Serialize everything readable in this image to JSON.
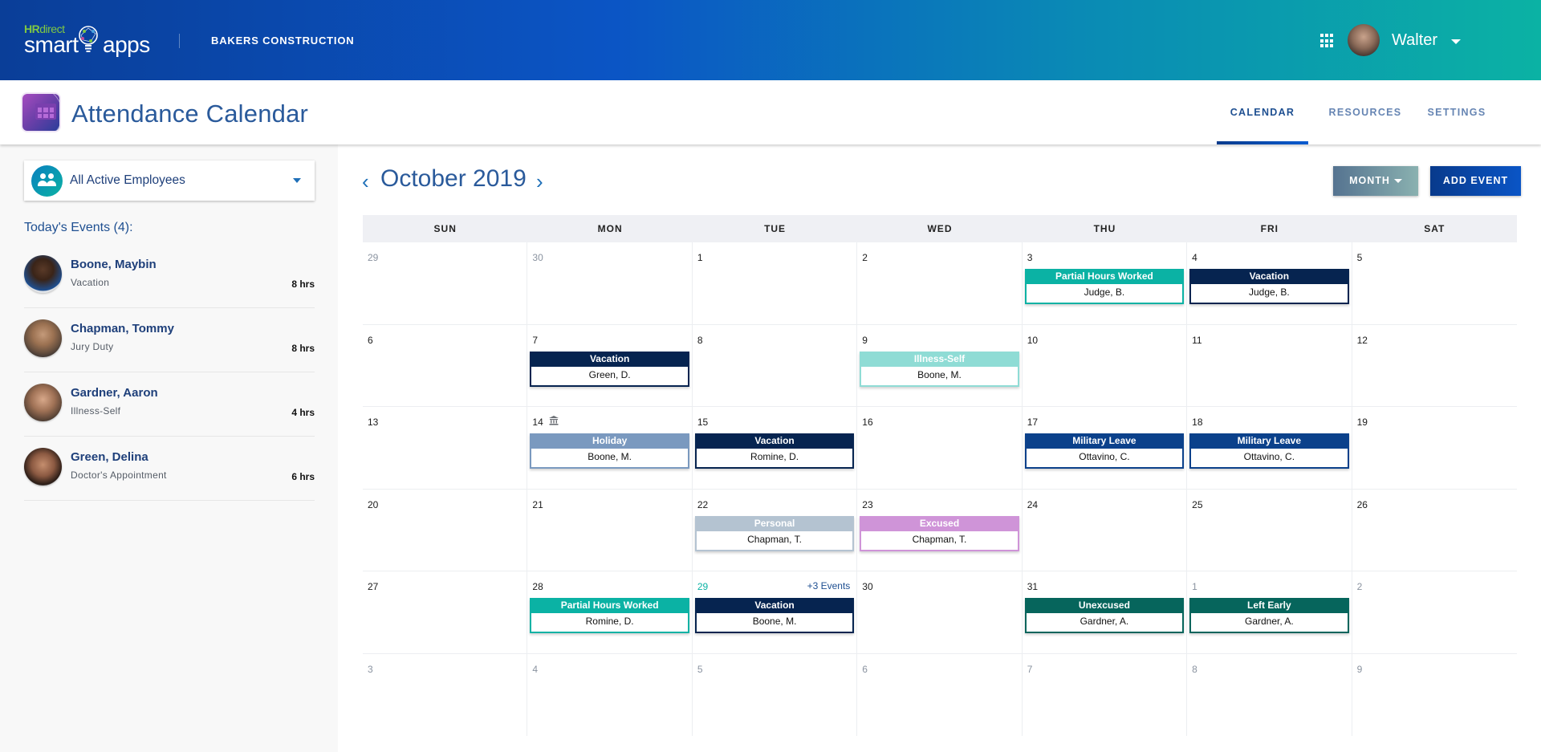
{
  "topbar": {
    "logo": {
      "brand_prefix": "HR",
      "brand_suffix": "direct",
      "word1": "smart",
      "word2": "apps"
    },
    "company": "BAKERS CONSTRUCTION",
    "apps_icon": "grid-icon",
    "user": {
      "name": "Walter",
      "avatar": "user-avatar"
    }
  },
  "appbar": {
    "title": "Attendance Calendar",
    "tabs": [
      {
        "label": "CALENDAR",
        "active": true
      },
      {
        "label": "RESOURCES",
        "active": false
      },
      {
        "label": "SETTINGS",
        "active": false
      }
    ]
  },
  "sidebar": {
    "employee_filter": "All Active Employees",
    "today_title": "Today's Events (4):",
    "events": [
      {
        "name": "Boone, Maybin",
        "type": "Vacation",
        "hours": "8 hrs"
      },
      {
        "name": "Chapman, Tommy",
        "type": "Jury Duty",
        "hours": "8 hrs"
      },
      {
        "name": "Gardner, Aaron",
        "type": "Illness-Self",
        "hours": "4 hrs"
      },
      {
        "name": "Green, Delina",
        "type": "Doctor's Appointment",
        "hours": "6 hrs"
      }
    ]
  },
  "calendar": {
    "prev_icon": "‹",
    "next_icon": "›",
    "month_title": "October 2019",
    "view_button": "MONTH",
    "add_button": "ADD EVENT",
    "weekdays": [
      "SUN",
      "MON",
      "TUE",
      "WED",
      "THU",
      "FRI",
      "SAT"
    ],
    "colors": {
      "vacation": "#062450",
      "partial": "#0bb2a4",
      "illness": "#8fdcd5",
      "holiday": "#7a99bf",
      "military": "#0b418b",
      "personal": "#b4c3d1",
      "excused": "#cf94d8",
      "unexcused": "#06655c",
      "today": "#0bb2a4"
    },
    "days": [
      {
        "d": "29",
        "other": true
      },
      {
        "d": "30",
        "other": true
      },
      {
        "d": "1"
      },
      {
        "d": "2"
      },
      {
        "d": "3",
        "event": {
          "type": "Partial Hours Worked",
          "name": "Judge, B.",
          "color": "partial"
        }
      },
      {
        "d": "4",
        "event": {
          "type": "Vacation",
          "name": "Judge, B.",
          "color": "vacation"
        }
      },
      {
        "d": "5"
      },
      {
        "d": "6"
      },
      {
        "d": "7",
        "event": {
          "type": "Vacation",
          "name": "Green, D.",
          "color": "vacation"
        }
      },
      {
        "d": "8"
      },
      {
        "d": "9",
        "event": {
          "type": "Illness-Self",
          "name": "Boone, M.",
          "color": "illness"
        }
      },
      {
        "d": "10"
      },
      {
        "d": "11"
      },
      {
        "d": "12"
      },
      {
        "d": "13"
      },
      {
        "d": "14",
        "holiday_icon": true,
        "event": {
          "type": "Holiday",
          "name": "Boone, M.",
          "color": "holiday"
        }
      },
      {
        "d": "15",
        "event": {
          "type": "Vacation",
          "name": "Romine, D.",
          "color": "vacation"
        }
      },
      {
        "d": "16"
      },
      {
        "d": "17",
        "event": {
          "type": "Military Leave",
          "name": "Ottavino, C.",
          "color": "military"
        }
      },
      {
        "d": "18",
        "event": {
          "type": "Military Leave",
          "name": "Ottavino, C.",
          "color": "military"
        }
      },
      {
        "d": "19"
      },
      {
        "d": "20"
      },
      {
        "d": "21"
      },
      {
        "d": "22",
        "event": {
          "type": "Personal",
          "name": "Chapman, T.",
          "color": "personal"
        }
      },
      {
        "d": "23",
        "event": {
          "type": "Excused",
          "name": "Chapman, T.",
          "color": "excused"
        }
      },
      {
        "d": "24"
      },
      {
        "d": "25"
      },
      {
        "d": "26"
      },
      {
        "d": "27"
      },
      {
        "d": "28",
        "event": {
          "type": "Partial Hours Worked",
          "name": "Romine, D.",
          "color": "partial"
        }
      },
      {
        "d": "29",
        "today": true,
        "more": "+3 Events",
        "event": {
          "type": "Vacation",
          "name": "Boone, M.",
          "color": "vacation"
        }
      },
      {
        "d": "30"
      },
      {
        "d": "31",
        "event": {
          "type": "Unexcused",
          "name": "Gardner, A.",
          "color": "unexcused"
        }
      },
      {
        "d": "1",
        "other": true,
        "event": {
          "type": "Left Early",
          "name": "Gardner, A.",
          "color": "unexcused"
        }
      },
      {
        "d": "2",
        "other": true
      },
      {
        "d": "3",
        "other": true
      },
      {
        "d": "4",
        "other": true
      },
      {
        "d": "5",
        "other": true
      },
      {
        "d": "6",
        "other": true
      },
      {
        "d": "7",
        "other": true
      },
      {
        "d": "8",
        "other": true
      },
      {
        "d": "9",
        "other": true
      }
    ]
  }
}
